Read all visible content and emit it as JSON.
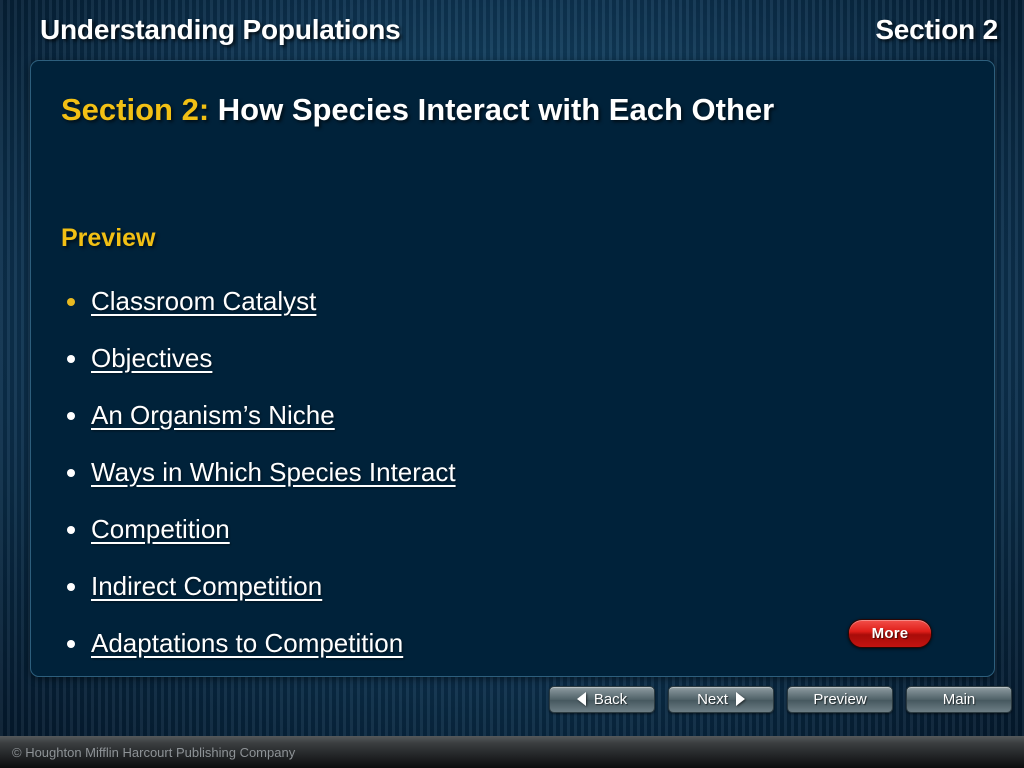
{
  "header": {
    "title": "Understanding Populations",
    "section": "Section 2"
  },
  "slide": {
    "title_prefix": "Section 2:",
    "title_rest": " How Species Interact with Each Other",
    "preview_heading": "Preview",
    "links": [
      {
        "label": "Classroom Catalyst",
        "bullet_color": "#e8b920"
      },
      {
        "label": "Objectives",
        "bullet_color": "#ffffff"
      },
      {
        "label": "An Organism’s Niche",
        "bullet_color": "#ffffff"
      },
      {
        "label": "Ways in Which Species Interact",
        "bullet_color": "#ffffff"
      },
      {
        "label": "Competition",
        "bullet_color": "#ffffff"
      },
      {
        "label": "Indirect Competition",
        "bullet_color": "#ffffff"
      },
      {
        "label": "Adaptations to Competition",
        "bullet_color": "#ffffff"
      }
    ],
    "more_button": "More"
  },
  "navbar": {
    "back": "Back",
    "next": "Next",
    "preview": "Preview",
    "main": "Main"
  },
  "footer": {
    "copyright": "© Houghton Mifflin Harcourt Publishing Company"
  },
  "colors": {
    "accent_gold": "#f2c014",
    "bullet_gold": "#e8b920",
    "panel_bg": "#00223a",
    "more_red": "#e01f1a",
    "text_white": "#ffffff"
  }
}
